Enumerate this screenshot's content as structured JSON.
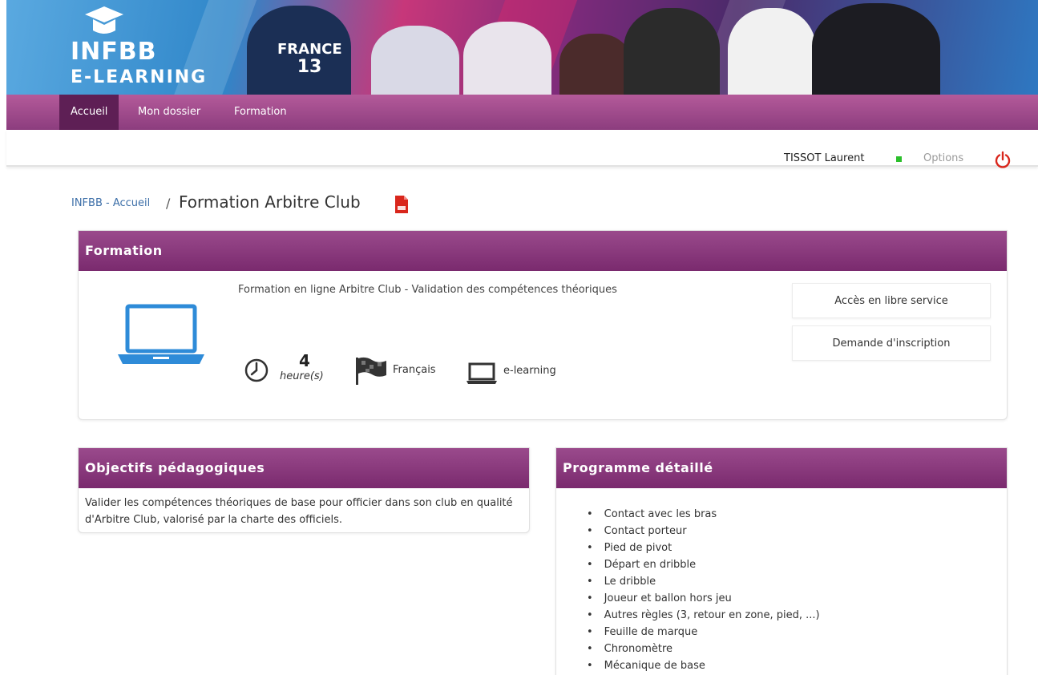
{
  "header": {
    "logo_title": "INFBB",
    "logo_subtitle": "E-LEARNING",
    "jersey_country": "FRANCE",
    "jersey_number": "13"
  },
  "nav": {
    "items": [
      {
        "label": "Accueil",
        "active": true
      },
      {
        "label": "Mon dossier",
        "active": false
      },
      {
        "label": "Formation",
        "active": false
      }
    ]
  },
  "userbar": {
    "user_name": "TISSOT Laurent",
    "status_color": "#2bbf2b",
    "options_label": "Options",
    "logout_icon": "power-icon"
  },
  "breadcrumb": {
    "home_label": "INFBB - Accueil",
    "separator": "/",
    "page_title": "Formation Arbitre Club",
    "export_icon": "pdf-icon"
  },
  "formation": {
    "heading": "Formation",
    "description": "Formation en ligne Arbitre Club - Validation des compétences théoriques",
    "duration_value": "4",
    "duration_unit": "heure(s)",
    "language": "Français",
    "modality": "e-learning",
    "actions": {
      "libre_service": "Accès en libre service",
      "inscription": "Demande d'inscription"
    }
  },
  "objectifs": {
    "heading": "Objectifs pédagogiques",
    "text": "Valider les compétences théoriques de base pour officier dans son club en qualité d'Arbitre Club, valorisé par la charte des officiels."
  },
  "programme": {
    "heading": "Programme détaillé",
    "items": [
      "Contact avec les bras",
      "Contact porteur",
      "Pied de pivot",
      "Départ en dribble",
      "Le dribble",
      "Joueur et ballon hors jeu",
      "Autres règles (3, retour en zone, pied, ...)",
      "Feuille de marque",
      "Chronomètre",
      "Mécanique de base"
    ]
  },
  "colors": {
    "nav_bg": "#8c3d7e",
    "nav_active": "#5e1f55",
    "panel_header": "#7a2a6e",
    "link": "#3d6fa8",
    "laptop_blue": "#2e8bd8",
    "pdf_red": "#d9261c",
    "power_red": "#d9261c"
  }
}
